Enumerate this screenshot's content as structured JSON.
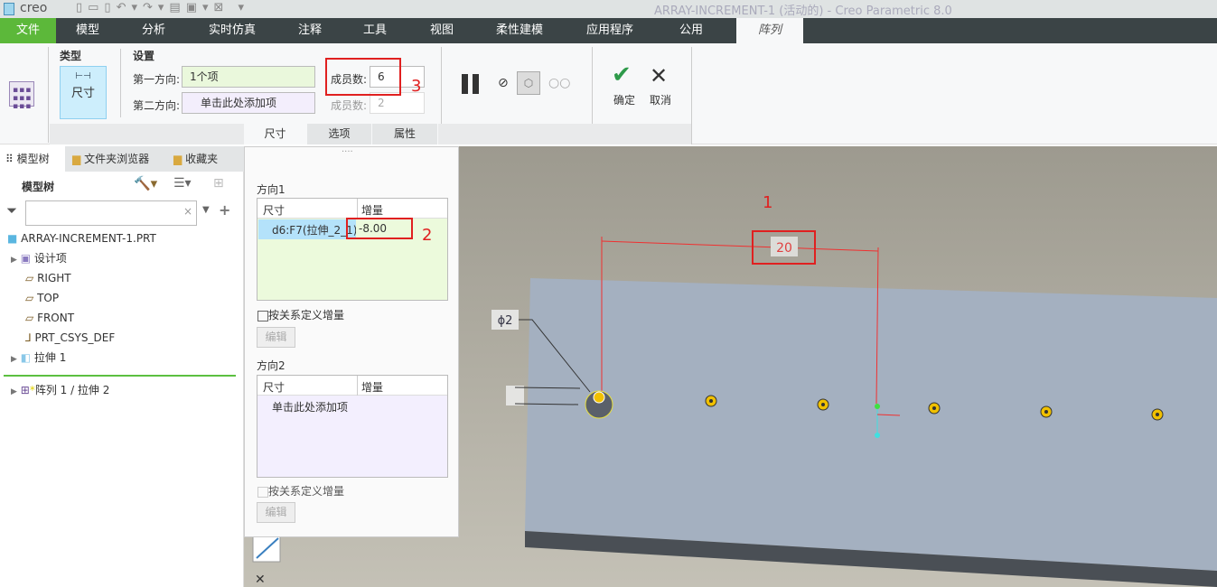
{
  "titlebar": {
    "logo": "creo",
    "title": "ARRAY-INCREMENT-1 (活动的) - Creo Parametric 8.0"
  },
  "menu": [
    "文件",
    "模型",
    "分析",
    "实时仿真",
    "注释",
    "工具",
    "视图",
    "柔性建模",
    "应用程序",
    "公用",
    "阵列"
  ],
  "ribbon": {
    "type_label": "类型",
    "type_button": "尺寸",
    "settings_label": "设置",
    "dir1_label": "第一方向:",
    "dir1_value": "1个项",
    "dir2_label": "第二方向:",
    "dir2_value": "单击此处添加项",
    "members_label": "成员数:",
    "members1_value": "6",
    "members2_value": "2",
    "ok_label": "确定",
    "cancel_label": "取消"
  },
  "subtabs": [
    "尺寸",
    "选项",
    "属性"
  ],
  "left": {
    "tabs": [
      "模型树",
      "文件夹浏览器",
      "收藏夹"
    ],
    "header": "模型树",
    "search_placeholder": "",
    "items": [
      {
        "label": "ARRAY-INCREMENT-1.PRT",
        "icon": "part-icon"
      },
      {
        "label": "设计项",
        "icon": "design-items-icon"
      },
      {
        "label": "RIGHT",
        "icon": "plane-icon"
      },
      {
        "label": "TOP",
        "icon": "plane-icon"
      },
      {
        "label": "FRONT",
        "icon": "plane-icon"
      },
      {
        "label": "PRT_CSYS_DEF",
        "icon": "csys-icon"
      },
      {
        "label": "拉伸 1",
        "icon": "extrude-icon"
      },
      {
        "label": "阵列 1 / 拉伸 2",
        "icon": "pattern-icon"
      }
    ]
  },
  "dash": {
    "dir1_title": "方向1",
    "col_dim": "尺寸",
    "col_inc": "增量",
    "dir1_row": {
      "dim": "d6:F7(拉伸_2_1)",
      "inc": "-8.00"
    },
    "relation_label": "按关系定义增量",
    "edit_label": "编辑",
    "dir2_title": "方向2",
    "dir2_placeholder": "单击此处添加项"
  },
  "viewport": {
    "dim_value": "20",
    "diameter_label": "ϕ2"
  },
  "annotations": [
    "1",
    "2",
    "3"
  ],
  "colors": {
    "accent_green": "#5cb83a",
    "highlight_red": "#e02020",
    "plate": "#a4b0c0"
  }
}
